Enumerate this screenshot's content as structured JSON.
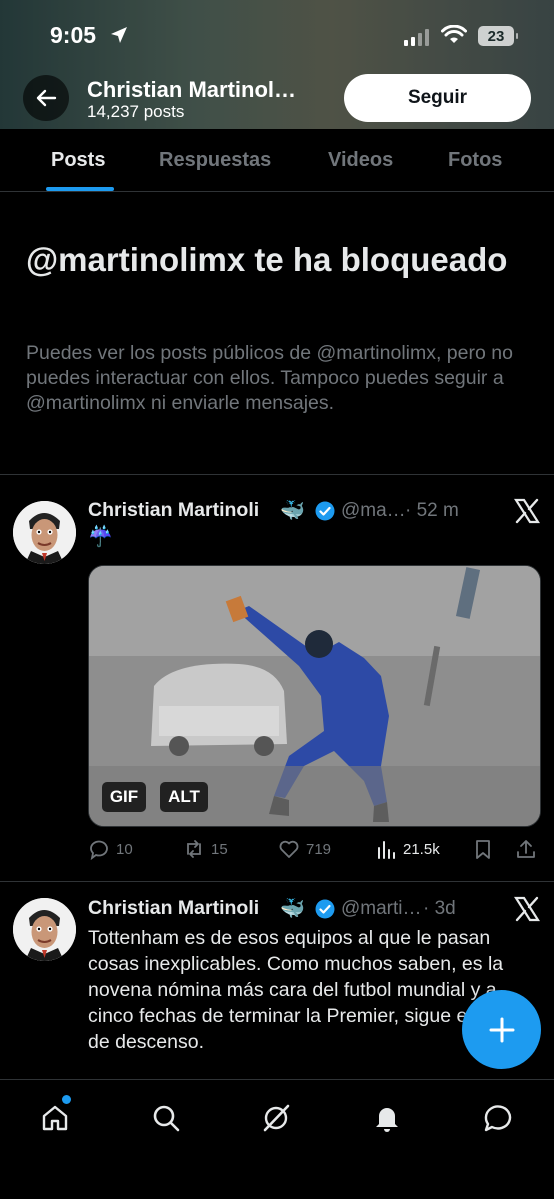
{
  "status_bar": {
    "time": "9:05",
    "battery": "23"
  },
  "header": {
    "name": "Christian Martinol…",
    "posts_count": "14,237 posts",
    "follow_label": "Seguir"
  },
  "tabs": [
    {
      "label": "Posts"
    },
    {
      "label": "Respuestas"
    },
    {
      "label": "Videos"
    },
    {
      "label": "Fotos"
    }
  ],
  "blocked": {
    "title": "@martinolimx te ha bloqueado",
    "description": "Puedes ver los posts públicos de @martinolimx, pero no puedes interactuar con ellos. Tampoco puedes seguir a @martinolimx ni enviarle mensajes."
  },
  "tweets": [
    {
      "name": "Christian Martinoli",
      "badge_emoji": "🐳",
      "handle": "@ma…",
      "time": "· 52 m",
      "text": "☔",
      "media_badges": [
        "GIF",
        "ALT"
      ],
      "replies": "10",
      "reposts": "15",
      "likes": "719",
      "views": "21.5k"
    },
    {
      "name": "Christian Martinoli",
      "badge_emoji": "🐳",
      "handle": "@marti…",
      "time": "· 3d",
      "text": "Tottenham es de esos equipos al que le pasan cosas inexplicables. Como muchos saben, es la novena nómina más cara del futbol mundial y a cinco fechas de terminar la Premier, sigue en zona de descenso."
    }
  ],
  "colors": {
    "accent": "#1d9bf0",
    "background": "#000000",
    "muted": "#71767b"
  }
}
